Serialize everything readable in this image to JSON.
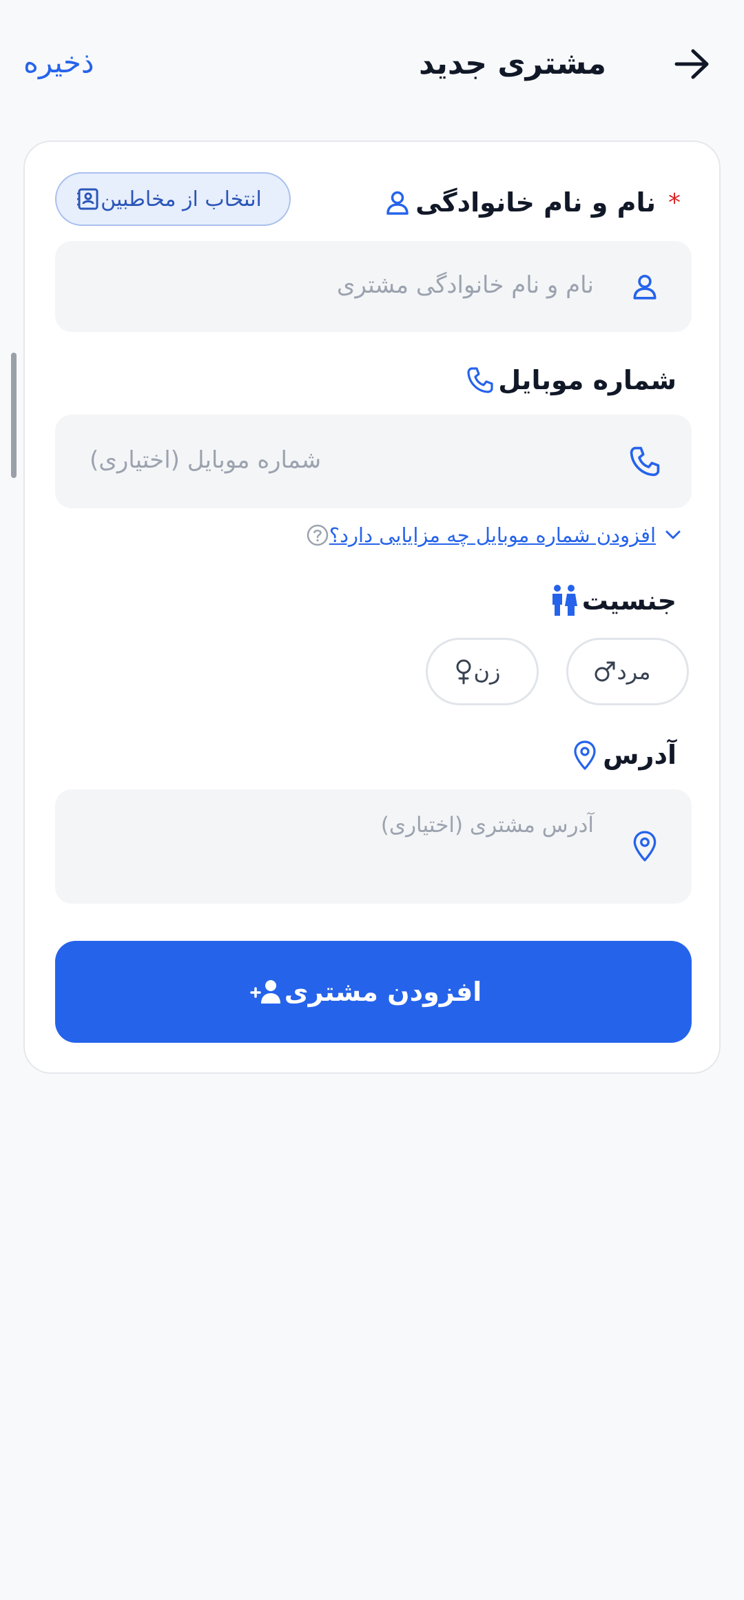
{
  "header": {
    "title": "مشتری جدید",
    "save_label": "ذخیره",
    "back_icon": "arrow-right-icon"
  },
  "form": {
    "name": {
      "label": "نام و نام خانوادگی",
      "required_mark": "*",
      "placeholder": "نام و نام خانوادگی مشتری",
      "contacts_button": "انتخاب از مخاطبین"
    },
    "mobile": {
      "label": "شماره موبایل",
      "placeholder": "شماره موبایل (اختیاری)",
      "hint": "افزودن شماره موبایل چه مزایایی دارد؟"
    },
    "gender": {
      "label": "جنسیت",
      "options": [
        {
          "label": "مرد",
          "icon": "male-icon"
        },
        {
          "label": "زن",
          "icon": "female-icon"
        }
      ]
    },
    "address": {
      "label": "آدرس",
      "placeholder": "آدرس مشتری (اختیاری)"
    },
    "submit_label": "افزودن مشتری"
  },
  "colors": {
    "accent": "#2563eb",
    "required": "#dc2626",
    "background": "#f8f9fb"
  }
}
